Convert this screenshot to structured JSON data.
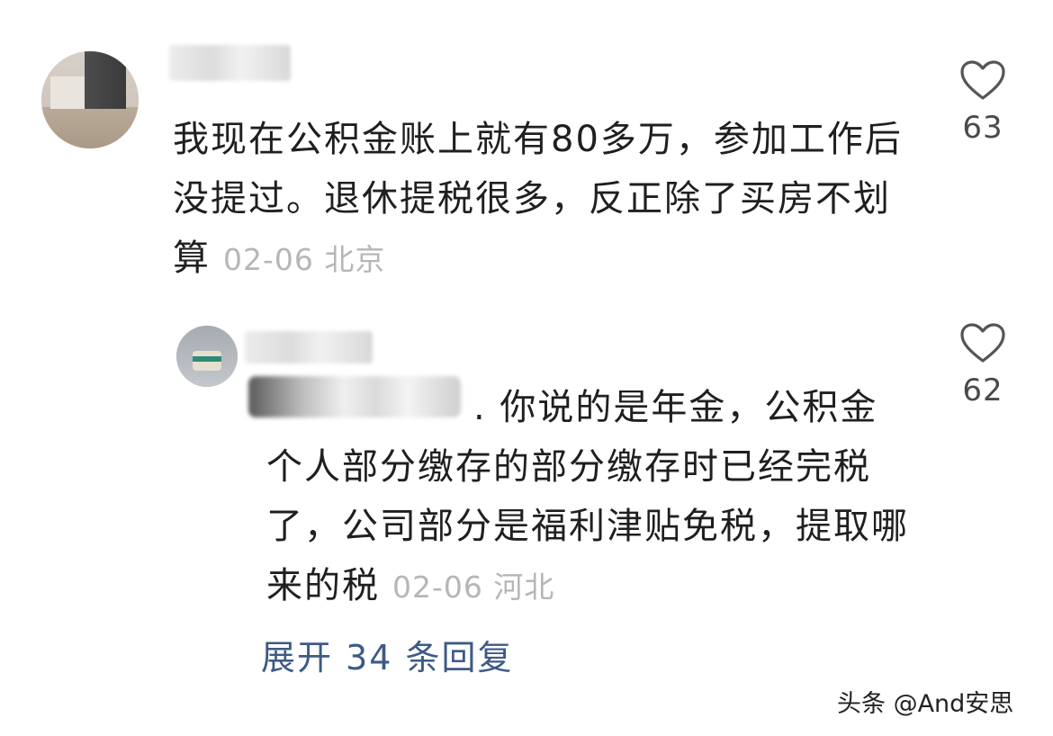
{
  "comments": [
    {
      "text": "我现在公积金账上就有80多万，参加工作后没提过。退休提税很多，反正除了买房不划算",
      "date": "02-06",
      "location": "北京",
      "likes": "63"
    }
  ],
  "reply": {
    "text": ". 你说的是年金，公积金个人部分缴存的部分缴存时已经完税了，公司部分是福利津贴免税，提取哪来的税",
    "date": "02-06",
    "location": "河北",
    "likes": "62"
  },
  "expand_label": "展开 34 条回复",
  "watermark": "头条 @And安思",
  "icons": {
    "like": "heart-outline-icon"
  },
  "colors": {
    "text": "#1f1f1f",
    "meta": "#b6b6b6",
    "link": "#3e5a85",
    "icon": "#555555"
  }
}
